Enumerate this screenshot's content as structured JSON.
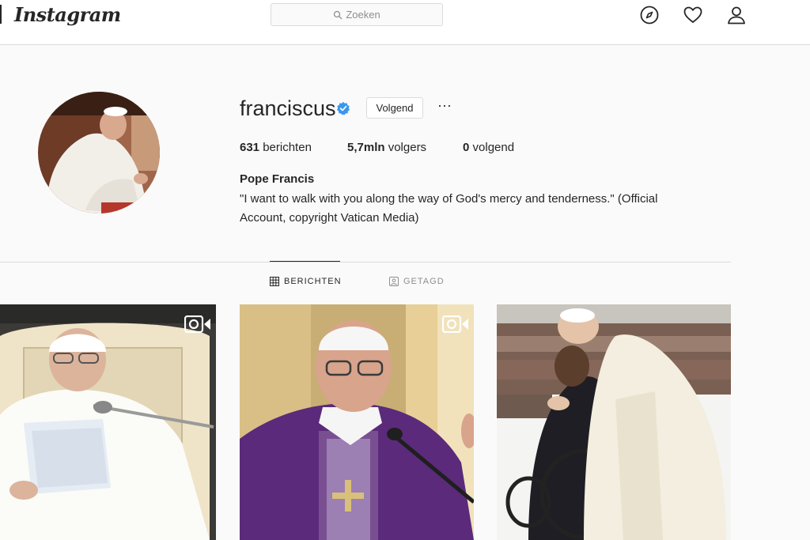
{
  "header": {
    "logo": "Instagram",
    "search_placeholder": "Zoeken"
  },
  "profile": {
    "username": "franciscus",
    "follow_label": "Volgend",
    "more_label": "···",
    "stats": {
      "posts_count": "631",
      "posts_label": "berichten",
      "followers_count": "5,7mln",
      "followers_label": "volgers",
      "following_count": "0",
      "following_label": "volgend"
    },
    "full_name": "Pope Francis",
    "bio": "\"I want to walk with you along the way of God's mercy and tenderness.\" (Official Account, copyright Vatican Media)"
  },
  "tabs": [
    {
      "label": "BERICHTEN",
      "active": true
    },
    {
      "label": "GETAGD",
      "active": false
    }
  ],
  "icons": {
    "nav": [
      "compass-icon",
      "heart-icon",
      "user-icon"
    ],
    "verified": "verified-badge-icon",
    "video": "video-icon"
  },
  "colors": {
    "verified_blue": "#3897f0",
    "text": "#262626",
    "muted": "#8e8e8e",
    "border": "#dbdbdb"
  }
}
